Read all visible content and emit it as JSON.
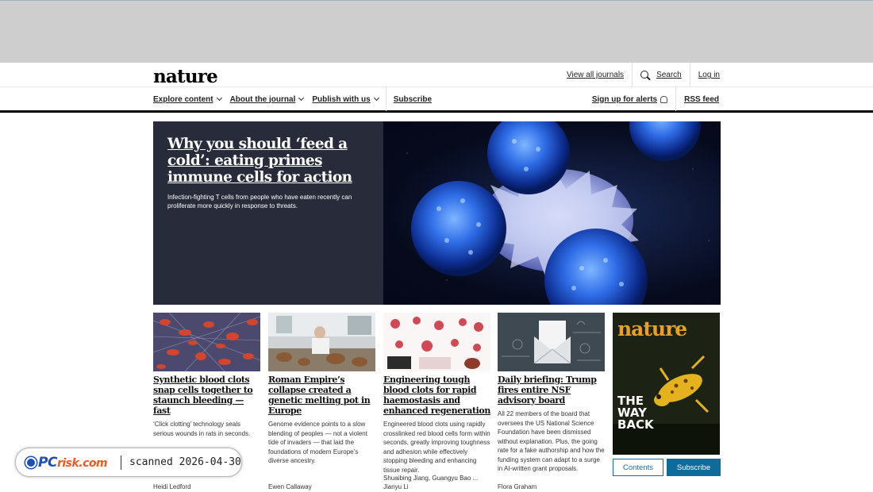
{
  "header": {
    "logo": "nature",
    "view_all_journals": "View all journals",
    "search": "Search",
    "login": "Log in"
  },
  "nav": {
    "explore": "Explore content",
    "about": "About the journal",
    "publish": "Publish with us",
    "subscribe": "Subscribe",
    "alerts": "Sign up for alerts",
    "rss": "RSS feed"
  },
  "hero": {
    "title": "Why you should ‘feed a cold’: eating primes immune cells for action",
    "description": "Infection-fighting T cells from people who have eaten recently can proliferate more quickly in response to threats."
  },
  "cards": [
    {
      "title": "Synthetic blood clots snap cells together to staunch bleeding — fast",
      "description": "‘Click clotting’ technology seals serious wounds in rats in seconds.",
      "author": "Heidi Ledford"
    },
    {
      "title": "Roman Empire’s collapse created a genetic melting pot in Europe",
      "description": "Genome evidence points to a slow blending of peoples — not a violent tide of invaders — that laid the foundations of modern Europe’s diverse ancestry.",
      "author": "Ewen Callaway"
    },
    {
      "title": "Engineering tough blood clots for rapid haemostasis and enhanced regeneration",
      "description": "Engineered blood clots using rapidly crosslinked red blood cells form within seconds, greatly improving toughness and adhesion while effectively stopping bleeding and enhancing tissue repair.",
      "author_line1": "Shuaibing Jiang, Guangyu Bao ...",
      "author_line2": "Jianyu Li"
    },
    {
      "title": "Daily briefing: Trump fires entire NSF advisory board",
      "description": "All 22 members of the board that oversees the US National Science Foundation have been dismissed without explanation. Plus, the going rate for a fake authorship and how the funding system can adapt to a surge in AI-written grant proposals.",
      "author": "Flora Graham"
    }
  ],
  "magazine": {
    "name": "nature",
    "cover_line": "THE WAY BACK",
    "contents_button": "Contents",
    "subscribe_button": "Subscribe"
  },
  "watermark": {
    "brand_main": "PC",
    "brand_sub": "risk.com",
    "scanned": "scanned 2026-04-30"
  },
  "colors": {
    "hero_bg": "#272b3a",
    "button_blue": "#0f6b9c",
    "magazine_accent": "#e8a21e"
  }
}
